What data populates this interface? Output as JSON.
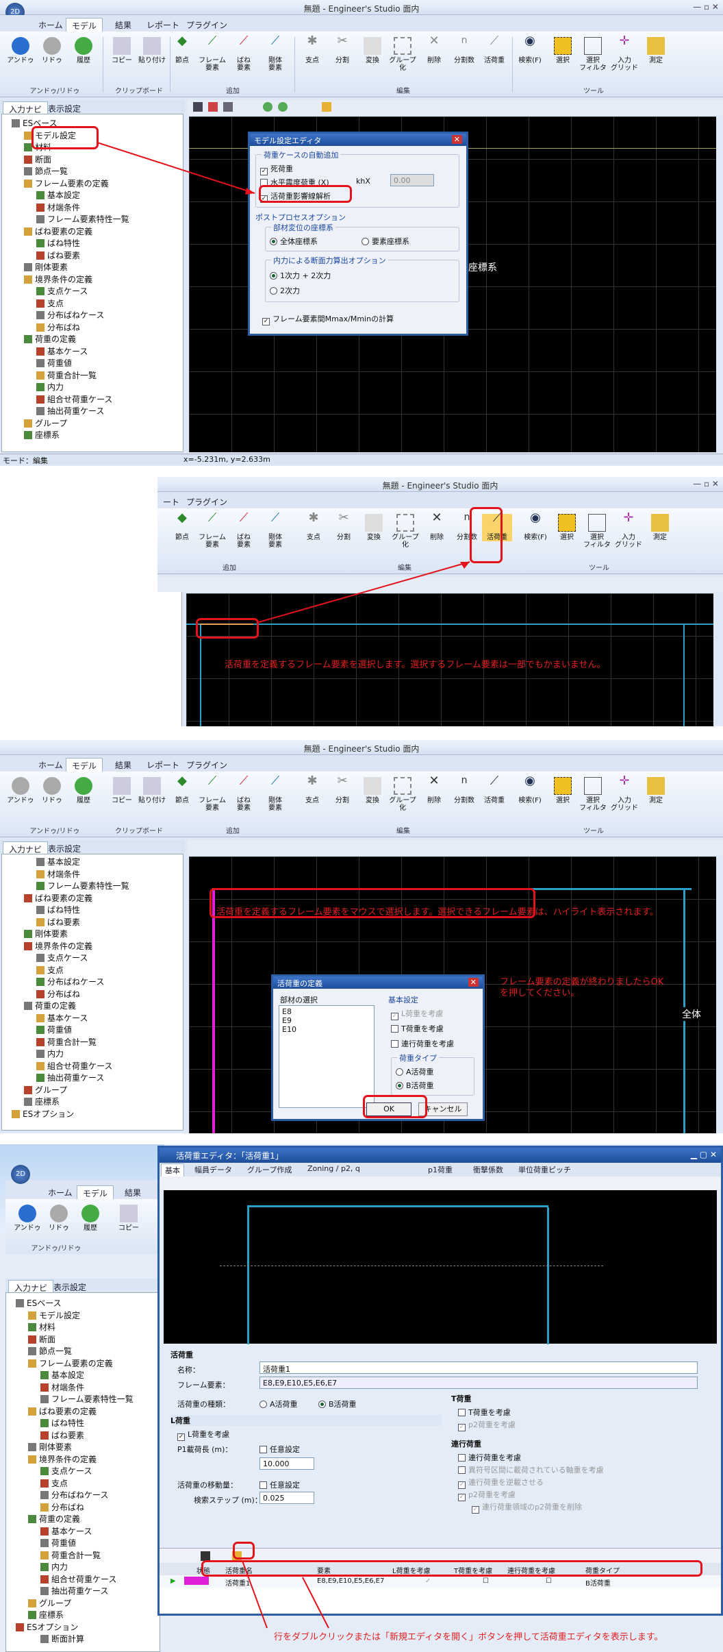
{
  "panel1": {
    "app_title": "無題 - Engineer's Studio 面内",
    "tabs": [
      "ホーム",
      "モデル",
      "結果",
      "レポート",
      "プラグイン"
    ],
    "ribbon": {
      "undo": "アンドゥ",
      "redo": "リドゥ",
      "history": "履歴",
      "copy": "コピー",
      "paste": "貼り付け",
      "node": "節点",
      "frame": "フレーム\n要素",
      "spring": "ばね\n要素",
      "rigid": "剛体\n要素",
      "support": "支点",
      "split": "分割",
      "transform": "変換",
      "group": "グループ\n化",
      "delete": "削除",
      "nsplit": "分割数",
      "liveload": "活荷重",
      "search": "検索(F)",
      "select": "選択",
      "filter": "選択\nフィルタ",
      "inputgrid": "入力\nグリッド",
      "measure": "測定",
      "groups": [
        "アンドゥ/リドゥ",
        "クリップボード",
        "追加",
        "編集",
        "ツール"
      ]
    },
    "left_tabs": [
      "入力ナビ",
      "表示設定"
    ],
    "tree": [
      "ESベース",
      "モデル設定",
      "材料",
      "断面",
      "節点一覧",
      "フレーム要素の定義",
      "基本設定",
      "材端条件",
      "フレーム要素特性一覧",
      "ばね要素の定義",
      "ばね特性",
      "ばね要素",
      "剛体要素",
      "境界条件の定義",
      "支点ケース",
      "支点",
      "分布ばねケース",
      "分布ばね",
      "荷重の定義",
      "基本ケース",
      "荷重値",
      "荷重合計一覧",
      "内力",
      "組合せ荷重ケース",
      "抽出荷重ケース",
      "グループ",
      "座標系"
    ],
    "dialog": {
      "title": "モデル設定エディタ",
      "g1": "荷重ケースの自動追加",
      "dead": "死荷重",
      "seismic": "水平震度荷重 (X)",
      "khx": "khX",
      "khx_val": "0.00",
      "live": "活荷重影響線解析",
      "g2": "ポストプロセスオプション",
      "g2a": "部材変位の座標系",
      "global": "全体座標系",
      "local": "要素座標系",
      "g2b": "内力による断面力算出オプション",
      "o1": "1次力 + 2次力",
      "o2": "2次力",
      "mm": "フレーム要素間Mmax/Mminの計算"
    },
    "canvas_label": "座標系",
    "status_mode": "モード：編集",
    "status_coord": "x=-5.231m, y=2.633m"
  },
  "panel2": {
    "app_title": "無題 - Engineer's Studio 面内",
    "tabs": [
      "ート",
      "プラグイン"
    ],
    "note": "活荷重を定義するフレーム要素を選択します。選択するフレーム要素は一部でもかまいません。"
  },
  "panel3": {
    "app_title": "無題 - Engineer's Studio 面内",
    "tree": [
      "基本設定",
      "材端条件",
      "フレーム要素特性一覧",
      "ばね要素の定義",
      "ばね特性",
      "ばね要素",
      "剛体要素",
      "境界条件の定義",
      "支点ケース",
      "支点",
      "分布ばねケース",
      "分布ばね",
      "荷重の定義",
      "基本ケース",
      "荷重値",
      "荷重合計一覧",
      "内力",
      "組合せ荷重ケース",
      "抽出荷重ケース",
      "グループ",
      "座標系",
      "ESオプション"
    ],
    "note1": "活荷重を定義するフレーム要素をマウスで選択します。選択できるフレーム要素は、ハイライト表示されます。",
    "note2": "フレーム要素の定義が終わりましたらOKを押してください。",
    "canvas_label": "全体",
    "dialog": {
      "title": "活荷重の定義",
      "members_label": "部材の選択",
      "members": [
        "E8",
        "E9",
        "E10"
      ],
      "basic": "基本設定",
      "l": "L荷重を考慮",
      "t": "T荷重を考慮",
      "moving": "連行荷重を考慮",
      "type": "荷重タイプ",
      "a": "A活荷重",
      "b": "B活荷重",
      "ok": "OK",
      "cancel": "キャンセル"
    }
  },
  "panel4": {
    "editor_title": "活荷重エディタ：「活荷重1」",
    "tabs": [
      "基本",
      "幅員データ",
      "グループ作成",
      "Zoning / p2, q",
      "p1荷重",
      "衝撃係数",
      "単位荷重ピッチ"
    ],
    "section": "活荷重",
    "name_label": "名称：",
    "name": "活荷重1",
    "frame_label": "フレーム要素：",
    "frame": "E8,E9,E10,E5,E6,E7",
    "kind_label": "活荷重の種類：",
    "a": "A活荷重",
    "b": "B活荷重",
    "l_section": "L荷重",
    "l_check": "L荷重を考慮",
    "p1_label": "P1載荷長 (m)：",
    "arbitrary": "任意設定",
    "p1_val": "10.000",
    "move_label": "活荷重の移動量：",
    "step_label": "検索ステップ (m)：",
    "step_val": "0.025",
    "t_section": "T荷重",
    "t_check": "T荷重を考慮",
    "p2_check": "p2荷重を考慮",
    "m_section": "連行荷重",
    "m_check": "連行荷重を考慮",
    "m1": "異符号区間に載荷されている軸重を考慮",
    "m2": "連行荷重を逆載させる",
    "m3": "p2荷重を考慮",
    "m4": "連行荷重領域のp2荷重を削除",
    "table_headers": [
      "状態",
      "活荷重名",
      "要素",
      "L荷重を考慮",
      "T荷重を考慮",
      "連行荷重を考慮",
      "荷重タイプ"
    ],
    "row": {
      "name": "活荷重1",
      "elements": "E8,E9,E10,E5,E6,E7",
      "type": "B活荷重"
    },
    "note": "行をダブルクリックまたは「新規エディタを開く」ボタンを押して活荷重エディタを表示します。",
    "bg_tabs": [
      "ホーム",
      "モデル",
      "結果"
    ],
    "bg_left_tabs": [
      "入力ナビ",
      "表示設定"
    ],
    "bg_tree": [
      "ESベース",
      "モデル設定",
      "材料",
      "断面",
      "節点一覧",
      "フレーム要素の定義",
      "基本設定",
      "材端条件",
      "フレーム要素特性一覧",
      "ばね要素の定義",
      "ばね特性",
      "ばね要素",
      "剛体要素",
      "境界条件の定義",
      "支点ケース",
      "支点",
      "分布ばねケース",
      "分布ばね",
      "荷重の定義",
      "基本ケース",
      "荷重値",
      "荷重合計一覧",
      "内力",
      "組合せ荷重ケース",
      "抽出荷重ケース",
      "グループ",
      "座標系",
      "ESオプション",
      "断面計算"
    ]
  },
  "colors": {
    "accent": "#e4121b",
    "ribbon": "#dae5f3",
    "frame_cyan": "#2aa0c8",
    "magenta": "#e020d8",
    "orange": "#e8a050"
  }
}
